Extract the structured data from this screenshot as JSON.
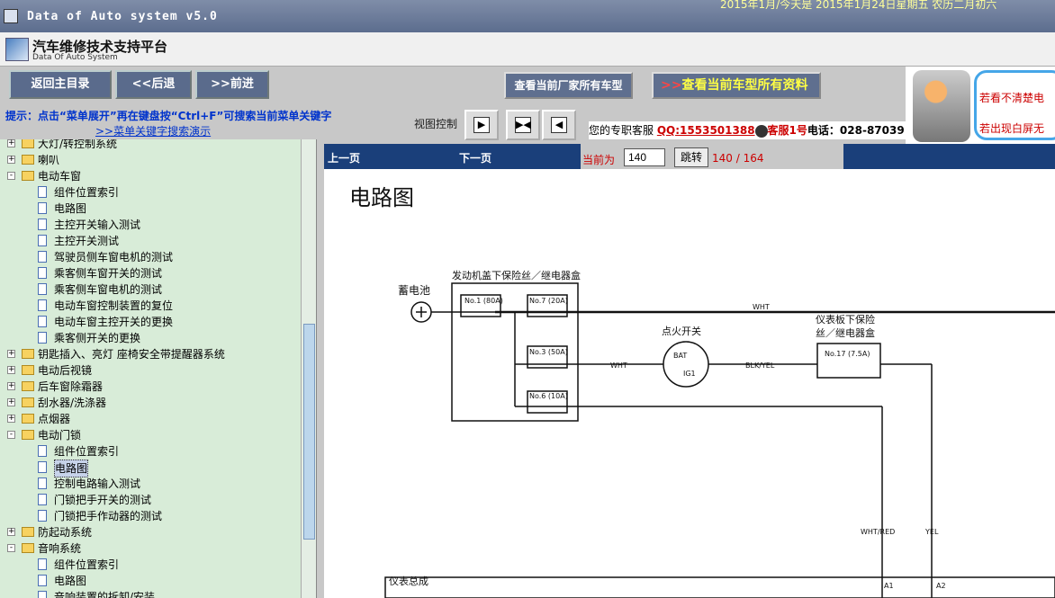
{
  "window": {
    "title": "Data of Auto system v5.0",
    "marquee": "2015年1月/今天是 2015年1月24日星期五 农历二月初六"
  },
  "brand": {
    "name": "汽车维修技术支持平台",
    "subtitle": "Data Of Auto System"
  },
  "toolbar": {
    "home": "返回主目录",
    "back": "<<后退",
    "forward": ">>前进",
    "all_models": "查看当前厂家所有车型",
    "all_data_arrows": ">>",
    "all_data": "查看当前车型所有资料",
    "hint": "提示：点击“菜单展开”再在键盘按“Ctrl+F”可搜索当前菜单关键字",
    "hint_link": ">>菜单关键字搜索演示",
    "view_control": "视图控制"
  },
  "service": {
    "prefix": "您的专职客服",
    "qq": "QQ:1553501388",
    "agent": "客服1号",
    "phone_label": "电话：",
    "phone": "028-87039"
  },
  "mascot": {
    "line1": "若看不清楚电",
    "line2": "若出现白屏无"
  },
  "tree": {
    "items": [
      {
        "level": 0,
        "type": "folder",
        "label": "大灯/转控制系统",
        "exp": "+"
      },
      {
        "level": 0,
        "type": "folder",
        "label": "喇叭",
        "exp": "+"
      },
      {
        "level": 0,
        "type": "folder",
        "label": "电动车窗",
        "exp": "-"
      },
      {
        "level": 1,
        "type": "page",
        "label": "组件位置索引"
      },
      {
        "level": 1,
        "type": "page",
        "label": "电路图"
      },
      {
        "level": 1,
        "type": "page",
        "label": "主控开关输入测试"
      },
      {
        "level": 1,
        "type": "page",
        "label": "主控开关测试"
      },
      {
        "level": 1,
        "type": "page",
        "label": "驾驶员侧车窗电机的测试"
      },
      {
        "level": 1,
        "type": "page",
        "label": "乘客侧车窗开关的测试"
      },
      {
        "level": 1,
        "type": "page",
        "label": "乘客侧车窗电机的测试"
      },
      {
        "level": 1,
        "type": "page",
        "label": "电动车窗控制装置的复位"
      },
      {
        "level": 1,
        "type": "page",
        "label": "电动车窗主控开关的更换"
      },
      {
        "level": 1,
        "type": "page",
        "label": "乘客侧开关的更换"
      },
      {
        "level": 0,
        "type": "folder",
        "label": "钥匙插入、亮灯 座椅安全带提醒器系统",
        "exp": "+"
      },
      {
        "level": 0,
        "type": "folder",
        "label": "电动后视镜",
        "exp": "+"
      },
      {
        "level": 0,
        "type": "folder",
        "label": "后车窗除霜器",
        "exp": "+"
      },
      {
        "level": 0,
        "type": "folder",
        "label": "刮水器/洗涤器",
        "exp": "+"
      },
      {
        "level": 0,
        "type": "folder",
        "label": "点烟器",
        "exp": "+"
      },
      {
        "level": 0,
        "type": "folder",
        "label": "电动门锁",
        "exp": "-"
      },
      {
        "level": 1,
        "type": "page",
        "label": "组件位置索引"
      },
      {
        "level": 1,
        "type": "page",
        "label": "电路图",
        "selected": true
      },
      {
        "level": 1,
        "type": "page",
        "label": "控制电路输入测试"
      },
      {
        "level": 1,
        "type": "page",
        "label": "门锁把手开关的测试"
      },
      {
        "level": 1,
        "type": "page",
        "label": "门锁把手作动器的测试"
      },
      {
        "level": 0,
        "type": "folder",
        "label": "防起动系统",
        "exp": "+"
      },
      {
        "level": 0,
        "type": "folder",
        "label": "音响系统",
        "exp": "-"
      },
      {
        "level": 1,
        "type": "page",
        "label": "组件位置索引"
      },
      {
        "level": 1,
        "type": "page",
        "label": "电路图"
      },
      {
        "level": 1,
        "type": "page",
        "label": "音响装置的拆卸/安装"
      }
    ]
  },
  "pager": {
    "prev": "上一页",
    "next": "下一页",
    "current_label": "当前为",
    "current": "140",
    "go": "跳转",
    "count": "140 / 164"
  },
  "document": {
    "title": "电路图",
    "battery": "蓄电池",
    "fusebox": "发动机盖下保险丝／继电器盒",
    "fuse1": "No.1 (80A)",
    "fuse7": "No.7 (20A)",
    "fuse3": "No.3 (50A)",
    "fuse6": "No.6 (10A)",
    "wht1": "WHT",
    "wht2": "WHT",
    "ign": "点火开关",
    "bat": "BAT",
    "ig1": "IG1",
    "blkyel": "BLK/YEL",
    "dash_fuse1": "仪表板下保险",
    "dash_fuse2": "丝／继电器盒",
    "fuse17": "No.17 (7.5A)",
    "whtred": "WHT/RED",
    "yel": "YEL",
    "a1": "A1",
    "a2": "A2",
    "instrument": "仪表总成"
  }
}
